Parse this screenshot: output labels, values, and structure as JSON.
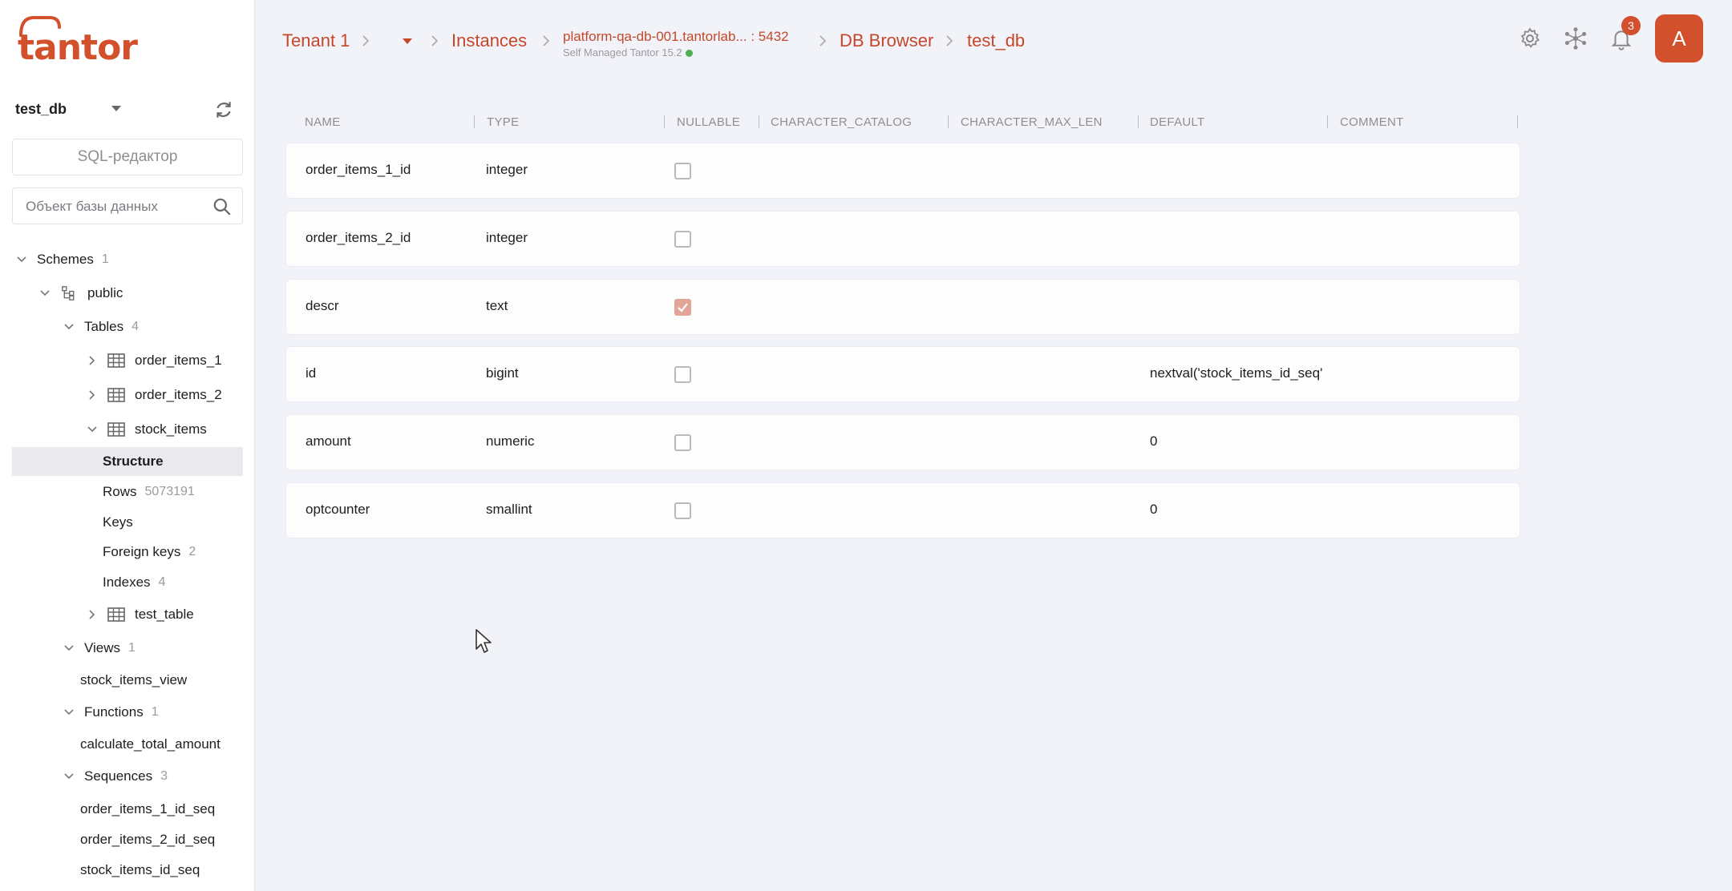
{
  "brand": {
    "logo_text": "tantor",
    "brand_color": "#d2502c"
  },
  "sidebar": {
    "database": "test_db",
    "sql_editor_label": "SQL-редактор",
    "search_placeholder": "Объект базы данных",
    "tree": {
      "schemes": {
        "label": "Schemes",
        "count": "1"
      },
      "public": {
        "label": "public"
      },
      "tables": {
        "label": "Tables",
        "count": "4"
      },
      "table_items": [
        "order_items_1",
        "order_items_2",
        "stock_items",
        "test_table"
      ],
      "stock_children": {
        "structure": "Structure",
        "rows": "Rows",
        "rows_count": "5073191",
        "keys": "Keys",
        "foreign_keys": "Foreign keys",
        "foreign_keys_count": "2",
        "indexes": "Indexes",
        "indexes_count": "4"
      },
      "views": {
        "label": "Views",
        "count": "1",
        "items": [
          "stock_items_view"
        ]
      },
      "functions": {
        "label": "Functions",
        "count": "1",
        "items": [
          "calculate_total_amount"
        ]
      },
      "sequences": {
        "label": "Sequences",
        "count": "3",
        "items": [
          "order_items_1_id_seq",
          "order_items_2_id_seq",
          "stock_items_id_seq"
        ]
      }
    }
  },
  "header": {
    "breadcrumbs": {
      "tenant": "Tenant 1",
      "instances": "Instances",
      "instance": "platform-qa-db-001.tantorlab... : 5432",
      "instance_sub": "Self Managed Tantor 15.2",
      "db_browser": "DB Browser",
      "database": "test_db"
    },
    "notifications_count": "3",
    "avatar_letter": "A"
  },
  "table": {
    "columns": [
      "NAME",
      "TYPE",
      "NULLABLE",
      "CHARACTER_CATALOG",
      "CHARACTER_MAX_LEN",
      "DEFAULT",
      "COMMENT"
    ],
    "rows": [
      {
        "name": "order_items_1_id",
        "type": "integer",
        "nullable": false,
        "default": ""
      },
      {
        "name": "order_items_2_id",
        "type": "integer",
        "nullable": false,
        "default": ""
      },
      {
        "name": "descr",
        "type": "text",
        "nullable": true,
        "default": ""
      },
      {
        "name": "id",
        "type": "bigint",
        "nullable": false,
        "default": "nextval('stock_items_id_seq'"
      },
      {
        "name": "amount",
        "type": "numeric",
        "nullable": false,
        "default": "0"
      },
      {
        "name": "optcounter",
        "type": "smallint",
        "nullable": false,
        "default": "0"
      }
    ]
  }
}
